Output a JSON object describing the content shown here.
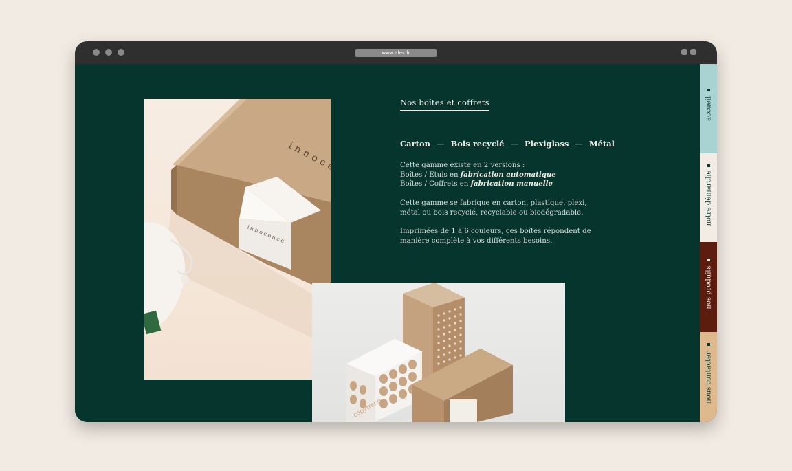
{
  "browser": {
    "url": "www.afec.fr"
  },
  "page": {
    "section_title": "Nos boîtes et coffrets",
    "materials": [
      "Carton",
      "Bois recyclé",
      "Plexiglass",
      "Métal"
    ],
    "separator": "—",
    "paragraph1": {
      "line1": "Cette gamme existe en 2 versions :",
      "line2_prefix": "Boîtes / Étuis en ",
      "line2_em": "fabrication automatique",
      "line3_prefix": "Boîtes / Coffrets en ",
      "line3_em": "fabrication manuelle"
    },
    "paragraph2": "Cette gamme se fabrique en carton, plastique, plexi, métal ou bois recyclé, recyclable ou biodégradable.",
    "paragraph3": "Imprimées de 1 à 6 couleurs, ces boîtes répondent de manière complète à vos différents besoins."
  },
  "photos": {
    "left_box_text": "innocence",
    "right_box_text": "copytrend"
  },
  "nav": {
    "items": [
      {
        "label": "accueil",
        "color": "#a9d2d2"
      },
      {
        "label": "notre démarche",
        "color": "#f3ece4"
      },
      {
        "label": "nos produits",
        "color": "#5c1d0e"
      },
      {
        "label": "nous contacter",
        "color": "#deb98d"
      }
    ]
  },
  "colors": {
    "background": "#06352d",
    "text": "#f2ece4",
    "page_bg": "#f1ebe3"
  }
}
